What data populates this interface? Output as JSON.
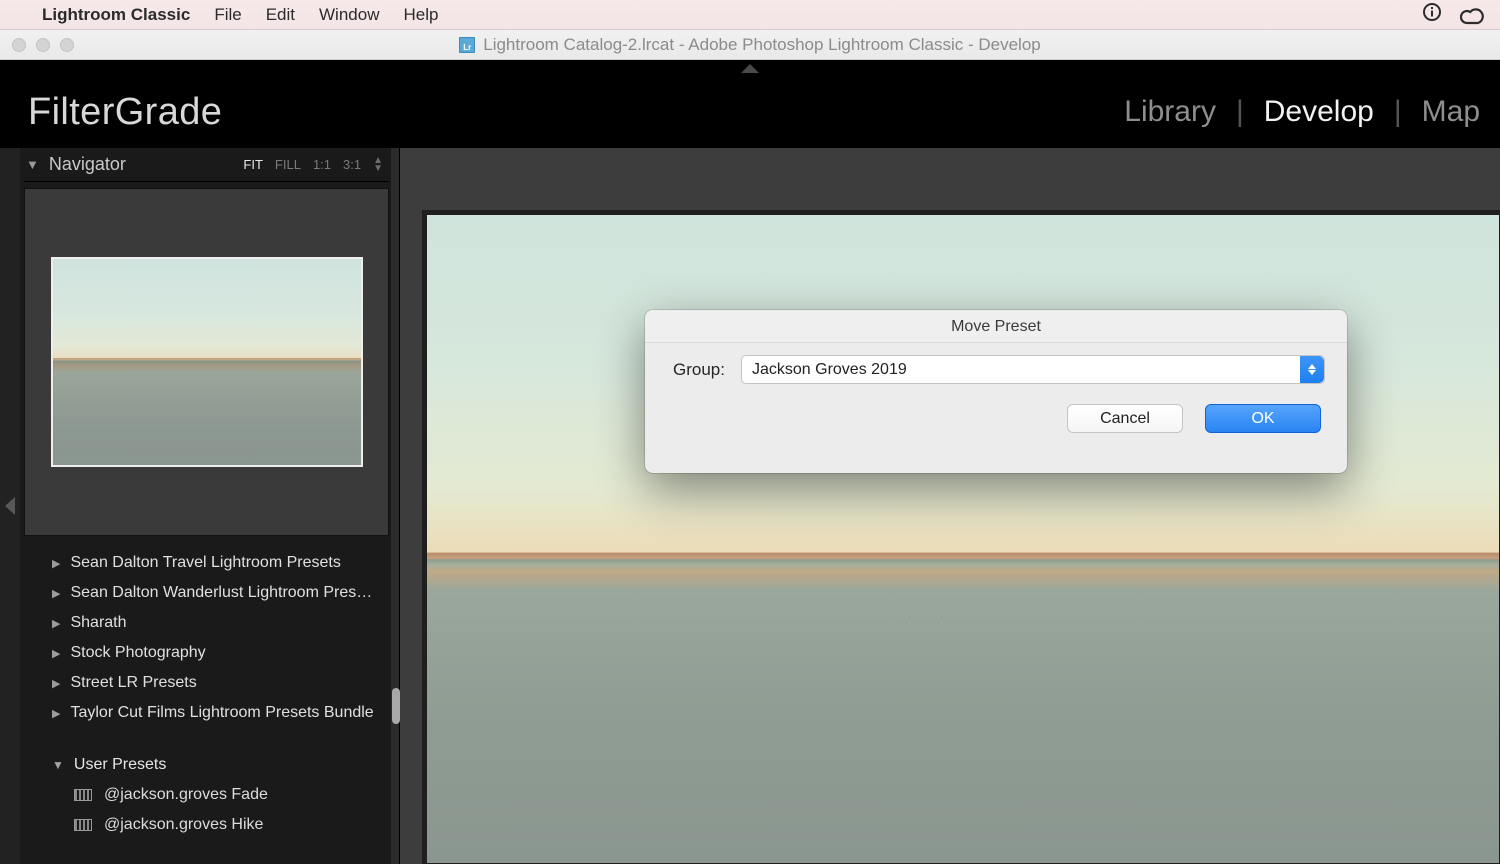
{
  "menubar": {
    "app": "Lightroom Classic",
    "items": [
      "File",
      "Edit",
      "Window",
      "Help"
    ]
  },
  "window": {
    "title": "Lightroom Catalog-2.lrcat - Adobe Photoshop Lightroom Classic - Develop"
  },
  "brand": "FilterGrade",
  "modules": {
    "items": [
      "Library",
      "Develop",
      "Map"
    ],
    "active": "Develop"
  },
  "navigator": {
    "title": "Navigator",
    "zoom": {
      "fit": "FIT",
      "fill": "FILL",
      "one": "1:1",
      "ratio": "3:1"
    },
    "selected": "FIT"
  },
  "presets": {
    "folders": [
      "Sean Dalton Travel Lightroom Presets",
      "Sean Dalton Wanderlust Lightroom Pres…",
      "Sharath",
      "Stock Photography",
      "Street LR Presets",
      "Taylor Cut Films Lightroom Presets Bundle"
    ],
    "user_section": "User Presets",
    "user_items": [
      "@jackson.groves Fade",
      "@jackson.groves Hike"
    ]
  },
  "dialog": {
    "title": "Move Preset",
    "label": "Group:",
    "value": "Jackson Groves 2019",
    "cancel": "Cancel",
    "ok": "OK"
  }
}
